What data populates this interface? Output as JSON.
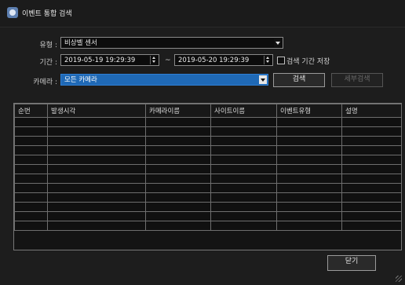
{
  "window": {
    "title": "이벤트 통합 검색"
  },
  "filters": {
    "type_label": "유형 :",
    "type_value": "비상벨 센서",
    "period_label": "기간 :",
    "start_datetime": "2019-05-19 19:29:39",
    "tilde": "~",
    "end_datetime": "2019-05-20 19:29:39",
    "save_period_label": "검색 기간 저장",
    "save_period_checked": false,
    "camera_label": "카메라 :",
    "camera_value": "모든 카메라"
  },
  "buttons": {
    "search": "검색",
    "detail_search": "세부검색",
    "close": "닫기"
  },
  "table": {
    "columns": [
      "순번",
      "발생시각",
      "카메라이름",
      "사이트이름",
      "이벤트유형",
      "설명"
    ],
    "empty_rows": 12
  }
}
